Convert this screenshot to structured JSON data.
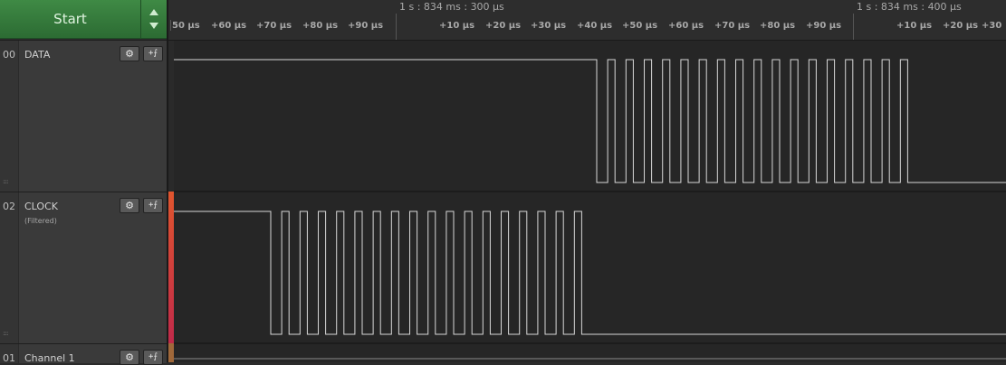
{
  "controls": {
    "start_label": "Start",
    "up_icon": "triangle-up-icon",
    "down_icon": "triangle-down-icon"
  },
  "timeline": {
    "absolute_labels": [
      "1 s : 834 ms : 300 µs",
      "1 s : 834 ms : 400 µs"
    ],
    "ticks_group1": [
      "50 µs",
      "+60 µs",
      "+70 µs",
      "+80 µs",
      "+90 µs"
    ],
    "ticks_group2": [
      "+10 µs",
      "+20 µs",
      "+30 µs",
      "+40 µs",
      "+50 µs",
      "+60 µs",
      "+70 µs",
      "+80 µs",
      "+90 µs"
    ],
    "ticks_group3": [
      "+10 µs",
      "+20 µs",
      "+30"
    ]
  },
  "channels": [
    {
      "number": "00",
      "name": "DATA",
      "subtitle": "",
      "color": "#2a2a2a",
      "settings_icon": "gear-icon",
      "trigger_icon": "trigger-edge-icon",
      "trigger_glyph": "+⨍"
    },
    {
      "number": "02",
      "name": "CLOCK",
      "subtitle": "(Filtered)",
      "color": "#d23a2c",
      "settings_icon": "gear-icon",
      "trigger_icon": "trigger-edge-icon",
      "trigger_glyph": "+⨍"
    },
    {
      "number": "01",
      "name": "Channel 1",
      "subtitle": "",
      "color": "#a0683a",
      "settings_icon": "gear-icon",
      "trigger_icon": "trigger-edge-icon",
      "trigger_glyph": "+⨍"
    }
  ],
  "waveforms": {
    "data_signal": {
      "initial_level": "high",
      "burst_pulses": 17,
      "final_level": "low"
    },
    "clock_signal": {
      "initial_level": "high",
      "burst_pulses": 17,
      "final_level": "low"
    }
  },
  "colors": {
    "start_green": "#3f8a45",
    "wave_line": "#d8d8d8",
    "background": "#262626"
  }
}
